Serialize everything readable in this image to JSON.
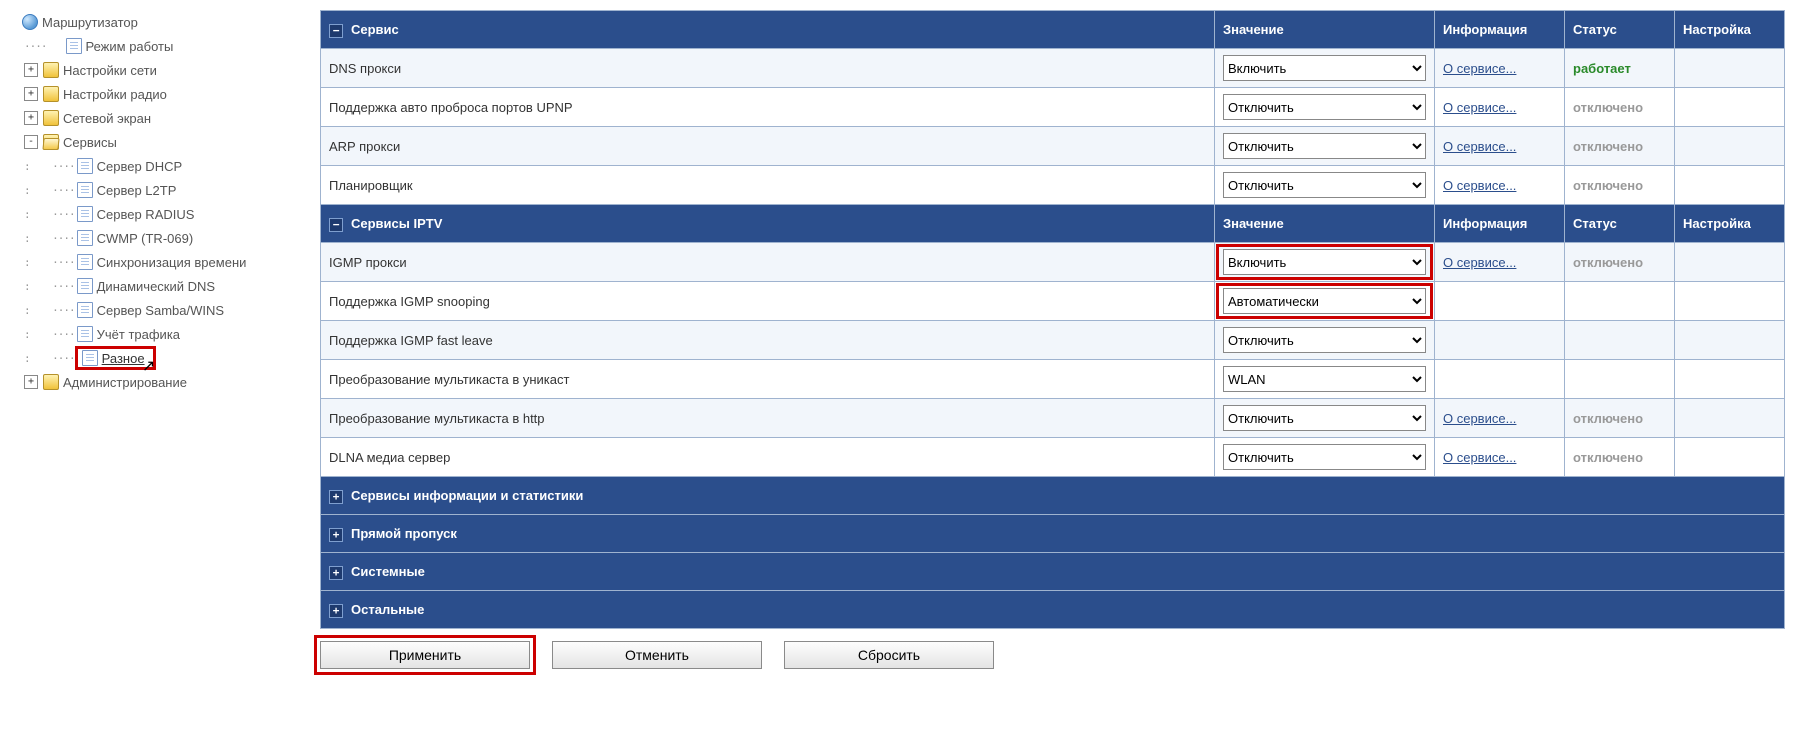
{
  "tree": {
    "root": {
      "label": "Маршрутизатор"
    },
    "items": [
      {
        "label": "Режим работы",
        "icon": "page",
        "exp": ""
      },
      {
        "label": "Настройки сети",
        "icon": "folder",
        "exp": "+"
      },
      {
        "label": "Настройки радио",
        "icon": "folder",
        "exp": "+"
      },
      {
        "label": "Сетевой экран",
        "icon": "folder",
        "exp": "+"
      },
      {
        "label": "Сервисы",
        "icon": "folder-open",
        "exp": "-",
        "children": [
          {
            "label": "Сервер DHCP"
          },
          {
            "label": "Сервер L2TP"
          },
          {
            "label": "Сервер RADIUS"
          },
          {
            "label": "CWMP (TR-069)"
          },
          {
            "label": "Синхронизация времени"
          },
          {
            "label": "Динамический DNS"
          },
          {
            "label": "Сервер Samba/WINS"
          },
          {
            "label": "Учёт трафика"
          },
          {
            "label": "Разное",
            "highlight": true
          }
        ]
      },
      {
        "label": "Администрирование",
        "icon": "folder",
        "exp": "+"
      }
    ]
  },
  "columns": {
    "name": "Сервис",
    "value": "Значение",
    "info": "Информация",
    "status": "Статус",
    "settings": "Настройка"
  },
  "columns2": {
    "name": "Сервисы IPTV",
    "value": "Значение",
    "info": "Информация",
    "status": "Статус",
    "settings": "Настройка"
  },
  "info_link_text": "О сервисе...",
  "status_labels": {
    "on": "работает",
    "off": "отключено"
  },
  "section1": [
    {
      "name": "DNS прокси",
      "value": "Включить",
      "info": true,
      "status": "on"
    },
    {
      "name": "Поддержка авто проброса портов UPNP",
      "value": "Отключить",
      "info": true,
      "status": "off"
    },
    {
      "name": "ARP прокси",
      "value": "Отключить",
      "info": true,
      "status": "off"
    },
    {
      "name": "Планировщик",
      "value": "Отключить",
      "info": true,
      "status": "off"
    }
  ],
  "section2": [
    {
      "name": "IGMP прокси",
      "value": "Включить",
      "info": true,
      "status": "off",
      "hl": true
    },
    {
      "name": "Поддержка IGMP snooping",
      "value": "Автоматически",
      "info": false,
      "status": "",
      "hl": true
    },
    {
      "name": "Поддержка IGMP fast leave",
      "value": "Отключить",
      "info": false,
      "status": ""
    },
    {
      "name": "Преобразование мультикаста в уникаст",
      "value": "WLAN",
      "info": false,
      "status": ""
    },
    {
      "name": "Преобразование мультикаста в http",
      "value": "Отключить",
      "info": true,
      "status": "off"
    },
    {
      "name": "DLNA медиа сервер",
      "value": "Отключить",
      "info": true,
      "status": "off"
    }
  ],
  "groups": [
    "Сервисы информации и статистики",
    "Прямой пропуск",
    "Системные",
    "Остальные"
  ],
  "buttons": {
    "apply": "Применить",
    "cancel": "Отменить",
    "reset": "Сбросить"
  }
}
